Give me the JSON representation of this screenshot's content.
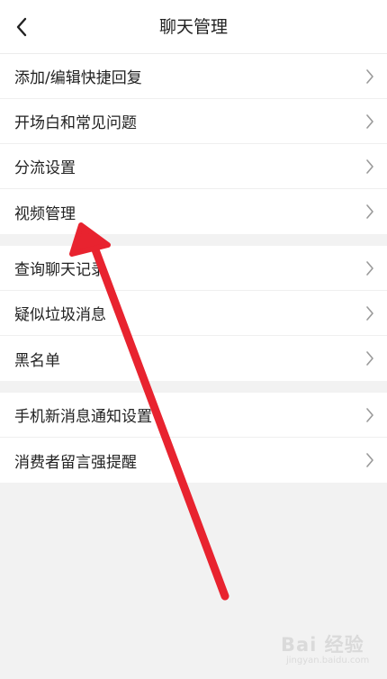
{
  "header": {
    "title": "聊天管理",
    "back_icon": "chevron-left-icon"
  },
  "groups": [
    {
      "items": [
        {
          "label": "添加/编辑快捷回复",
          "icon": "chevron-right-icon"
        },
        {
          "label": "开场白和常见问题",
          "icon": "chevron-right-icon"
        },
        {
          "label": "分流设置",
          "icon": "chevron-right-icon"
        },
        {
          "label": "视频管理",
          "icon": "chevron-right-icon"
        }
      ]
    },
    {
      "items": [
        {
          "label": "查询聊天记录",
          "icon": "chevron-right-icon"
        },
        {
          "label": "疑似垃圾消息",
          "icon": "chevron-right-icon"
        },
        {
          "label": "黑名单",
          "icon": "chevron-right-icon"
        }
      ]
    },
    {
      "items": [
        {
          "label": "手机新消息通知设置",
          "icon": "chevron-right-icon"
        },
        {
          "label": "消费者留言强提醒",
          "icon": "chevron-right-icon"
        }
      ]
    }
  ],
  "annotation": {
    "type": "arrow",
    "color": "#e8232f",
    "points_to": "视频管理"
  },
  "watermark": {
    "brand": "Bai 经验",
    "sub": "jingyan.baidu.com"
  },
  "colors": {
    "background": "#f2f2f2",
    "surface": "#ffffff",
    "text": "#222222",
    "chevron": "#9a9a9a",
    "divider": "#efefef"
  }
}
